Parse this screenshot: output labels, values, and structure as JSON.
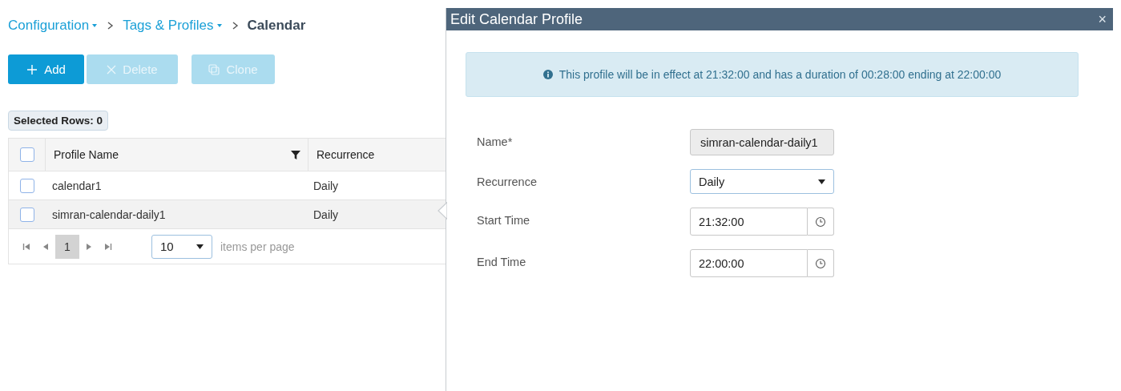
{
  "breadcrumb": [
    {
      "label": "Configuration",
      "kind": "menu"
    },
    {
      "label": "Tags & Profiles",
      "kind": "menu"
    },
    {
      "label": "Calendar",
      "kind": "current"
    }
  ],
  "toolbar": [
    {
      "label": "Add",
      "kind": "add",
      "disabled": false
    },
    {
      "label": "Delete",
      "kind": "delete",
      "disabled": true
    },
    {
      "label": "Clone",
      "kind": "clone",
      "disabled": true
    }
  ],
  "selected_rows": "Selected Rows: 0",
  "table": {
    "columns": [
      "Profile Name",
      "Recurrence"
    ],
    "header_checked": false,
    "rows": [
      {
        "cells": [
          "calendar1",
          "Daily"
        ],
        "checked": false,
        "selected": false
      },
      {
        "cells": [
          "simran-calendar-daily1",
          "Daily"
        ],
        "checked": false,
        "selected": true
      }
    ]
  },
  "pager": {
    "pages": [
      {
        "label": "1",
        "selected": true
      }
    ],
    "page_size": "10",
    "page_size_label": "items per page"
  },
  "panel": {
    "title": "Edit Calendar Profile",
    "close": "×",
    "info": "This profile will be in effect at 21:32:00 and has a duration of 00:28:00 ending at 22:00:00",
    "fields": [
      {
        "label": "Name*",
        "kind": "text",
        "value": "simran-calendar-daily1",
        "disabled": true
      },
      {
        "label": "Recurrence",
        "kind": "select",
        "value": "Daily"
      },
      {
        "label": "Start Time",
        "kind": "time",
        "value": "21:32:00"
      },
      {
        "label": "End Time",
        "kind": "time",
        "value": "22:00:00"
      }
    ]
  }
}
